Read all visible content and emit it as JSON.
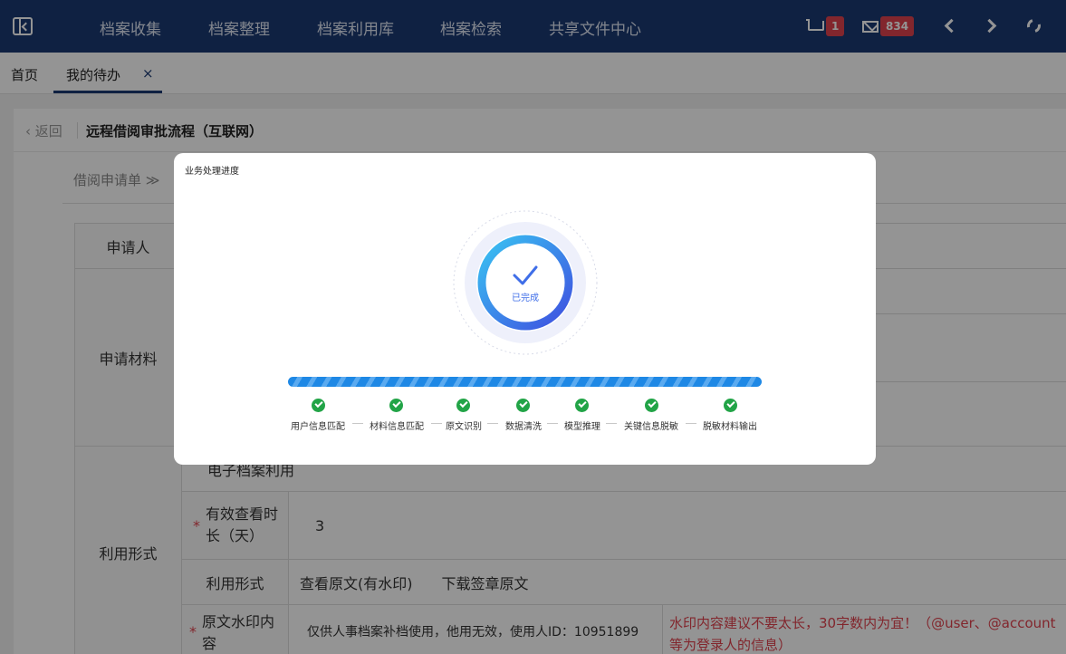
{
  "topnav": {
    "items": [
      "档案收集",
      "档案整理",
      "档案利用库",
      "档案检索",
      "共享文件中心"
    ],
    "cart_count": "1",
    "mail_count": "834"
  },
  "tabs": {
    "home": "首页",
    "active": "我的待办",
    "close": "×"
  },
  "page": {
    "back": "‹ 返回",
    "title": "远程借阅审批流程（互联网）",
    "section_tab": "借阅申请单 ≫"
  },
  "form": {
    "applicant_label": "申请人",
    "materials_label": "申请材料",
    "usage_label": "利用形式",
    "e_archive": "电子档案利用",
    "duration_label": "有效查看时长（天）",
    "duration_value": "3",
    "usage_form_label": "利用形式",
    "usage_options": [
      "查看原文(有水印)",
      "下载签章原文"
    ],
    "watermark_label": "原文水印内容",
    "watermark_value": "仅供人事档案补档使用，他用无效，使用人ID：10951899",
    "watermark_hint": "水印内容建议不要太长，30字数内为宜！（@user、@account等为登录人的信息）"
  },
  "modal": {
    "title": "业务处理进度",
    "status": "已完成",
    "steps": [
      "用户信息匹配",
      "材料信息匹配",
      "原文识别",
      "数据清洗",
      "模型推理",
      "关键信息脱敏",
      "脱敏材料输出"
    ]
  },
  "colors": {
    "nav_bg": "#1b3a73",
    "accent": "#1e88e5",
    "success": "#22a447",
    "danger": "#e0434e"
  }
}
